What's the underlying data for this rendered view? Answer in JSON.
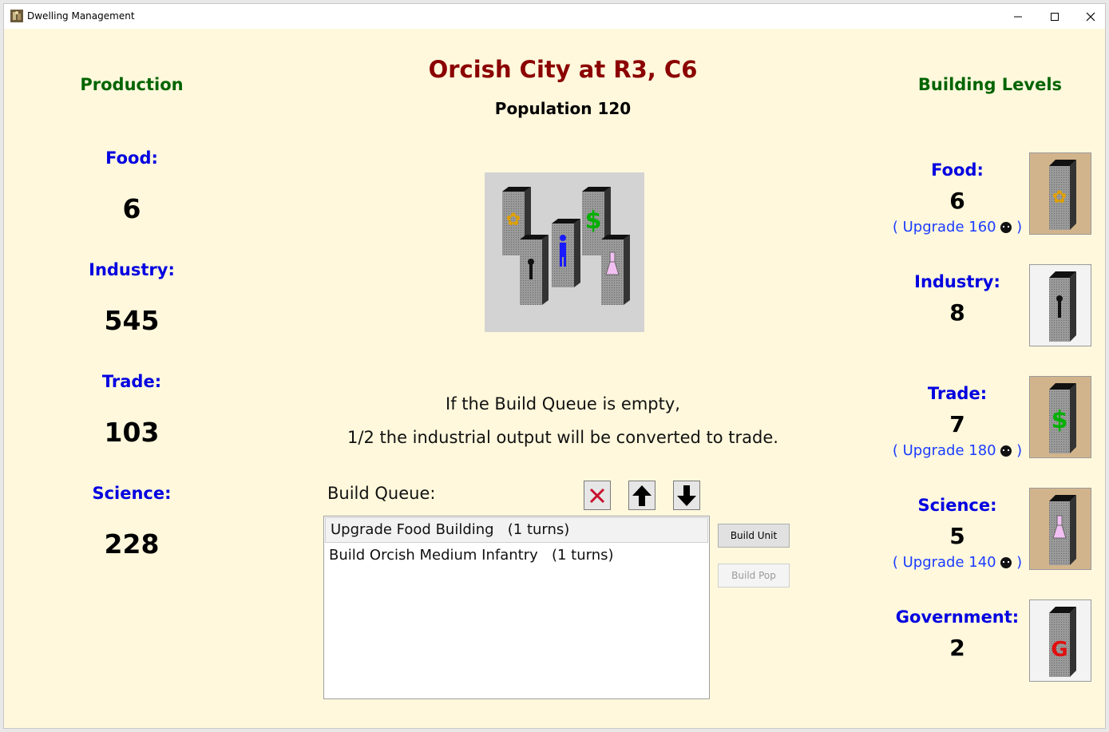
{
  "window": {
    "title": "Dwelling Management",
    "icons": {
      "app": "dwelling-icon",
      "minimize": "minimize-icon",
      "maximize": "maximize-icon",
      "close": "close-icon"
    }
  },
  "header": {
    "city_title": "Orcish City at R3, C6",
    "population": "Population 120"
  },
  "production": {
    "heading": "Production",
    "items": [
      {
        "label": "Food:",
        "value": "6"
      },
      {
        "label": "Industry:",
        "value": "545"
      },
      {
        "label": "Trade:",
        "value": "103"
      },
      {
        "label": "Science:",
        "value": "228"
      }
    ]
  },
  "building_levels": {
    "heading": "Building Levels",
    "items": [
      {
        "label": "Food:",
        "value": "6",
        "upgrade": "( Upgrade 160",
        "upgrade_end": ")",
        "icon": "food-building-icon",
        "icon_bg": "#d2b48c"
      },
      {
        "label": "Industry:",
        "value": "8",
        "upgrade": "",
        "upgrade_end": "",
        "icon": "industry-building-icon",
        "icon_bg": "#f3f3f3"
      },
      {
        "label": "Trade:",
        "value": "7",
        "upgrade": "( Upgrade 180",
        "upgrade_end": ")",
        "icon": "trade-building-icon",
        "icon_bg": "#d2b48c"
      },
      {
        "label": "Science:",
        "value": "5",
        "upgrade": "( Upgrade 140",
        "upgrade_end": ")",
        "icon": "science-building-icon",
        "icon_bg": "#d2b48c"
      },
      {
        "label": "Government:",
        "value": "2",
        "upgrade": "",
        "upgrade_end": "",
        "icon": "government-building-icon",
        "icon_bg": "#f3f3f3"
      }
    ]
  },
  "info": {
    "line1": "If the Build Queue is empty,",
    "line2": "1/2 the industrial output will be converted to trade."
  },
  "build_queue": {
    "label": "Build Queue:",
    "items": [
      "Upgrade Food Building   (1 turns)",
      "Build Orcish Medium Infantry   (1 turns)"
    ],
    "buttons": {
      "build_unit": "Build Unit",
      "build_pop": "Build Pop"
    }
  }
}
